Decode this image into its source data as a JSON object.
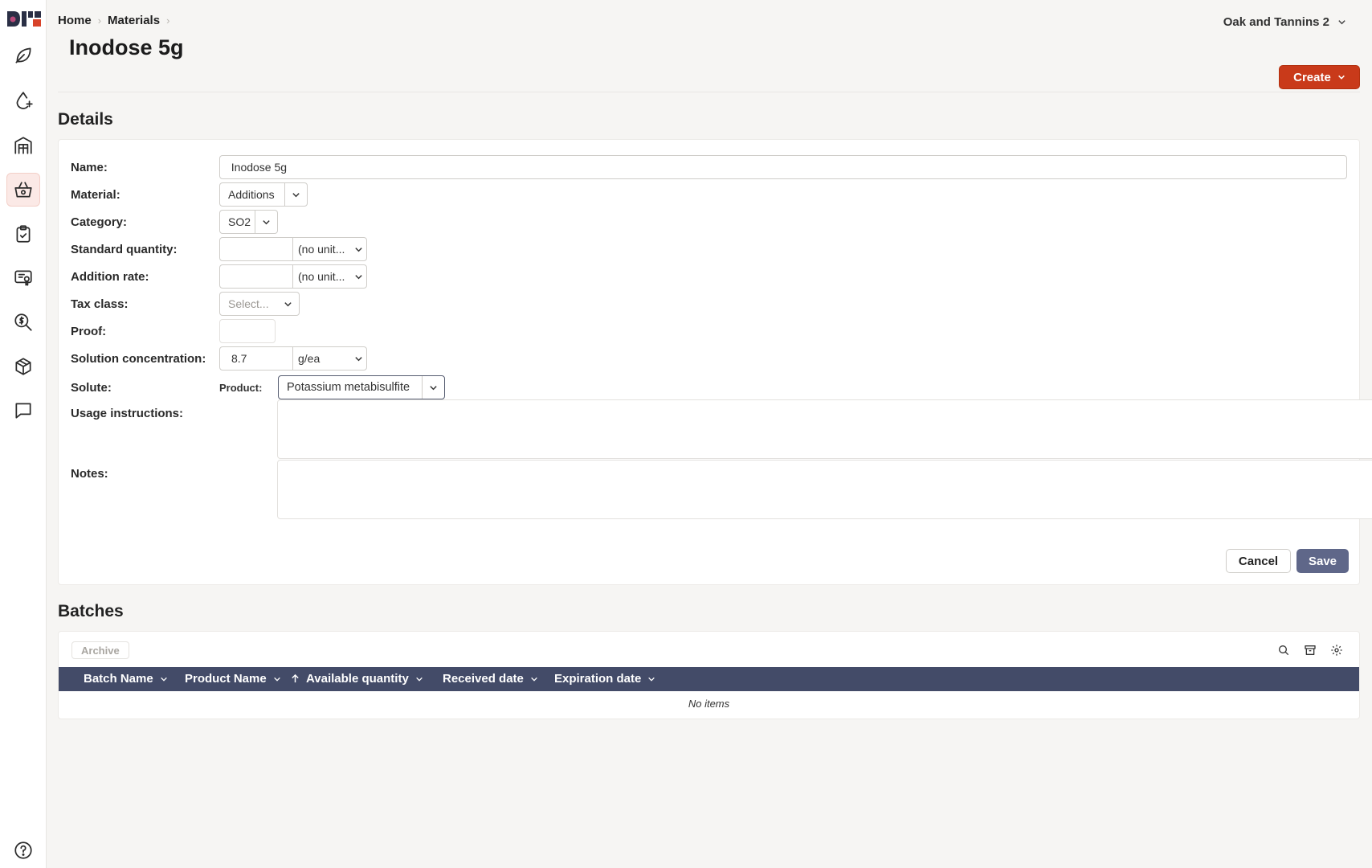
{
  "breadcrumb": [
    {
      "label": "Home"
    },
    {
      "label": "Materials"
    }
  ],
  "page": {
    "title": "Inodose 5g"
  },
  "org": {
    "name": "Oak and Tannins 2"
  },
  "create_button": {
    "label": "Create"
  },
  "details": {
    "title": "Details",
    "fields": {
      "name": {
        "label": "Name:",
        "value": "Inodose 5g"
      },
      "material": {
        "label": "Material:",
        "value": "Additions"
      },
      "category": {
        "label": "Category:",
        "value": "SO2"
      },
      "standard_quantity": {
        "label": "Standard quantity:",
        "value": "",
        "unit": "(no unit..."
      },
      "addition_rate": {
        "label": "Addition rate:",
        "value": "",
        "unit": "(no unit..."
      },
      "tax_class": {
        "label": "Tax class:",
        "placeholder": "Select..."
      },
      "proof": {
        "label": "Proof:",
        "value": ""
      },
      "solution_concentration": {
        "label": "Solution concentration:",
        "value": "8.7",
        "unit": "g/ea"
      },
      "solute": {
        "label": "Solute:",
        "sublabel": "Product:",
        "value": "Potassium metabisulfite"
      },
      "usage_instructions": {
        "label": "Usage instructions:",
        "value": ""
      },
      "notes": {
        "label": "Notes:",
        "value": ""
      }
    },
    "cancel_label": "Cancel",
    "save_label": "Save"
  },
  "batches": {
    "title": "Batches",
    "archive_label": "Archive",
    "columns": [
      "Batch Name",
      "Product Name",
      "Available quantity",
      "Received date",
      "Expiration date"
    ],
    "empty_text": "No items"
  },
  "colors": {
    "accent": "#c93a1a",
    "save": "#5f6789",
    "table_header": "#434b68",
    "background": "#f6f5f3"
  },
  "icons": {
    "sidebar": [
      "leaf-icon",
      "droplet-icon",
      "warehouse-icon",
      "basket-icon",
      "clipboard-check-icon",
      "certificate-icon",
      "search-dollar-icon",
      "package-icon",
      "chat-icon",
      "help-icon"
    ],
    "toolbar": [
      "search-icon",
      "archive-icon",
      "gear-icon"
    ]
  }
}
